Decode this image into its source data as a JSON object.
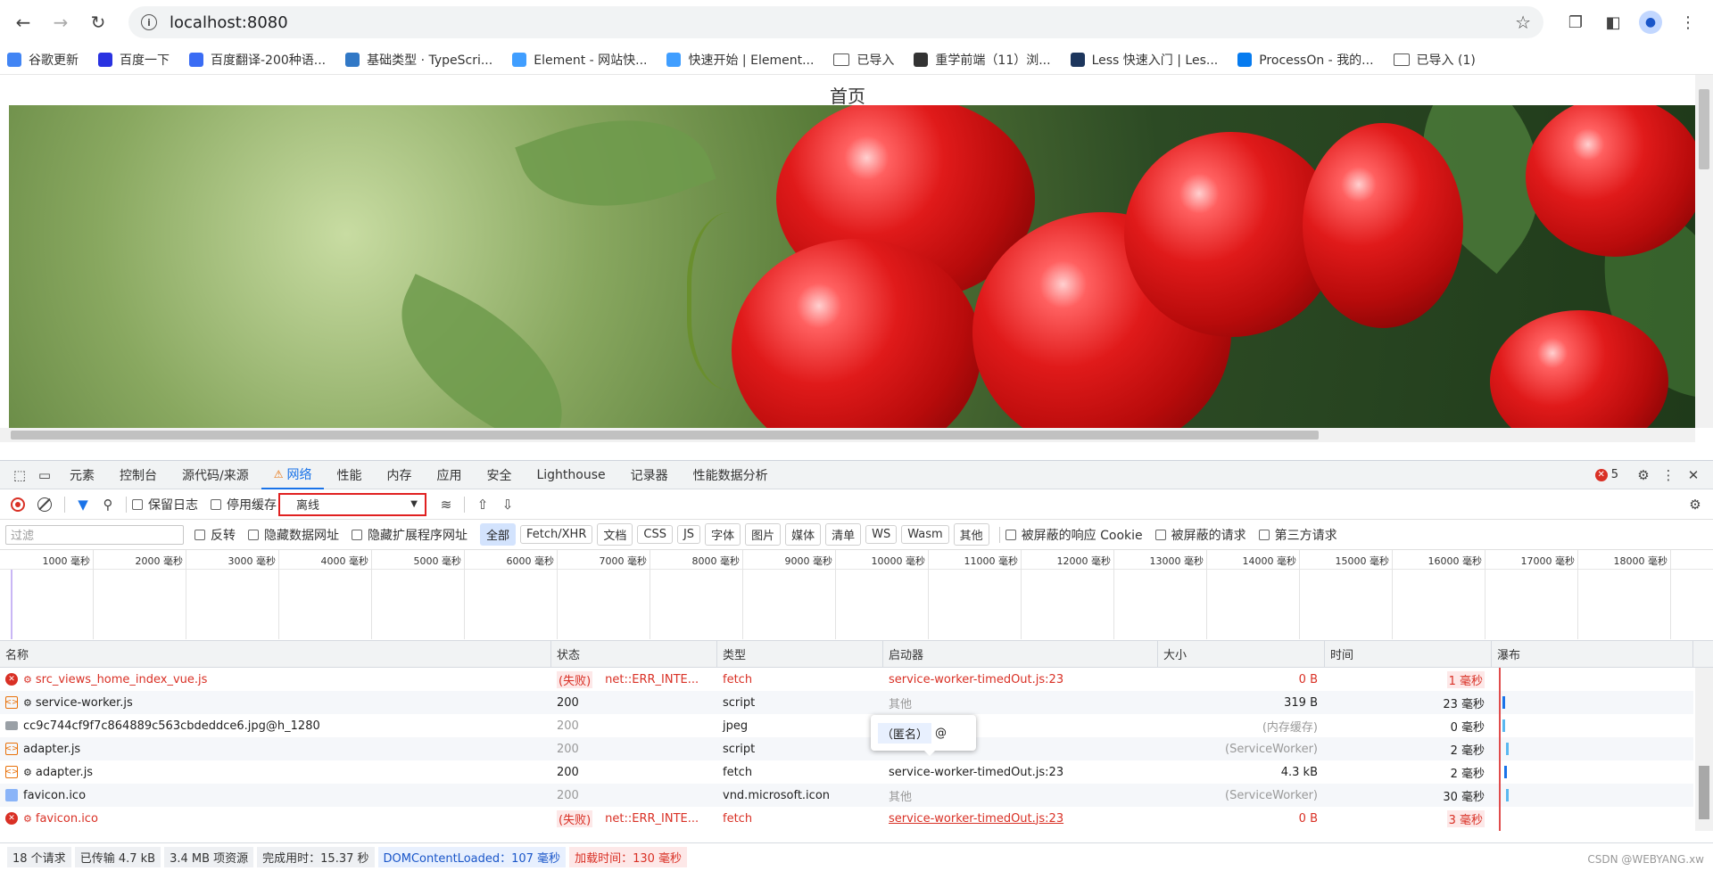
{
  "browser": {
    "url": "localhost:8080",
    "bookmarks": [
      {
        "label": "谷歌更新",
        "icon": "chrome-icon",
        "color": "#4285f4"
      },
      {
        "label": "百度一下",
        "icon": "baidu-icon",
        "color": "#2932e1"
      },
      {
        "label": "百度翻译-200种语...",
        "icon": "translate-icon",
        "color": "#3a6cf4"
      },
      {
        "label": "基础类型 · TypeScri...",
        "icon": "typescript-icon",
        "color": "#3178c6"
      },
      {
        "label": "Element - 网站快...",
        "icon": "element-icon",
        "color": "#409eff"
      },
      {
        "label": "快速开始 | Element...",
        "icon": "element-icon",
        "color": "#409eff"
      },
      {
        "label": "已导入",
        "icon": "folder-icon",
        "color": "#555555"
      },
      {
        "label": "重学前端（11）浏...",
        "icon": "bookmark-icon",
        "color": "#333333"
      },
      {
        "label": "Less 快速入门 | Les...",
        "icon": "less-icon",
        "color": "#1d365d"
      },
      {
        "label": "ProcessOn - 我的...",
        "icon": "processon-icon",
        "color": "#067bef"
      },
      {
        "label": "已导入 (1)",
        "icon": "folder-icon",
        "color": "#555555"
      }
    ]
  },
  "page": {
    "title": "首页"
  },
  "devtools": {
    "tabs": [
      "元素",
      "控制台",
      "源代码/来源",
      "网络",
      "性能",
      "内存",
      "应用",
      "安全",
      "Lighthouse",
      "记录器",
      "性能数据分析"
    ],
    "active_tab": "网络",
    "error_count": "5",
    "network": {
      "preserve_log": "保留日志",
      "disable_cache": "停用缓存",
      "throttle": "离线",
      "filter_placeholder": "过滤",
      "invert": "反转",
      "hide_data_urls": "隐藏数据网址",
      "hide_extension_urls": "隐藏扩展程序网址",
      "type_filters": [
        "全部",
        "Fetch/XHR",
        "文档",
        "CSS",
        "JS",
        "字体",
        "图片",
        "媒体",
        "清单",
        "WS",
        "Wasm",
        "其他"
      ],
      "blocked_cookies": "被屏蔽的响应 Cookie",
      "blocked_requests": "被屏蔽的请求",
      "third_party": "第三方请求",
      "timeline_ticks": [
        "1000 毫秒",
        "2000 毫秒",
        "3000 毫秒",
        "4000 毫秒",
        "5000 毫秒",
        "6000 毫秒",
        "7000 毫秒",
        "8000 毫秒",
        "9000 毫秒",
        "10000 毫秒",
        "11000 毫秒",
        "12000 毫秒",
        "13000 毫秒",
        "14000 毫秒",
        "15000 毫秒",
        "16000 毫秒",
        "17000 毫秒",
        "18000 毫秒"
      ],
      "columns": [
        "名称",
        "状态",
        "类型",
        "启动器",
        "大小",
        "时间",
        "瀑布"
      ],
      "rows": [
        {
          "name": "src_views_home_index_vue.js",
          "status": "(失败)",
          "status_detail": "net::ERR_INTE...",
          "type": "fetch",
          "initiator": "service-worker-timedOut.js:23",
          "size": "0 B",
          "time": "1 毫秒",
          "error": true,
          "icon": "error-icon",
          "sw": true
        },
        {
          "name": "service-worker.js",
          "status": "200",
          "status_detail": "",
          "type": "script",
          "initiator": "其他",
          "size": "319 B",
          "time": "23 毫秒",
          "error": false,
          "icon": "script-icon",
          "sw": true
        },
        {
          "name": "cc9c744cf9f7c864889c563cbdeddce6.jpg@h_1280",
          "status": "200",
          "status_detail": "",
          "type": "jpeg",
          "initiator": "",
          "size": "(内存缓存)",
          "time": "0 毫秒",
          "error": false,
          "icon": "image-icon",
          "sw": false
        },
        {
          "name": "adapter.js",
          "status": "200",
          "status_detail": "",
          "type": "script",
          "initiator": "",
          "size": "(ServiceWorker)",
          "time": "2 毫秒",
          "error": false,
          "icon": "script-icon",
          "sw": false
        },
        {
          "name": "adapter.js",
          "status": "200",
          "status_detail": "",
          "type": "fetch",
          "initiator": "service-worker-timedOut.js:23",
          "size": "4.3 kB",
          "time": "2 毫秒",
          "error": false,
          "icon": "script-icon",
          "sw": true
        },
        {
          "name": "favicon.ico",
          "status": "200",
          "status_detail": "",
          "type": "vnd.microsoft.icon",
          "initiator": "其他",
          "size": "(ServiceWorker)",
          "time": "30 毫秒",
          "error": false,
          "icon": "favicon-icon",
          "sw": false
        },
        {
          "name": "favicon.ico",
          "status": "(失败)",
          "status_detail": "net::ERR_INTE...",
          "type": "fetch",
          "initiator": "service-worker-timedOut.js:23",
          "size": "0 B",
          "time": "3 毫秒",
          "error": true,
          "icon": "error-icon",
          "sw": true
        }
      ],
      "tooltip": {
        "name": "（匿名）",
        "at": "@"
      },
      "status_bar": [
        "18 个请求",
        "已传输 4.7 kB",
        "3.4 MB 项资源",
        "完成用时：15.37 秒",
        "DOMContentLoaded：107 毫秒",
        "加载时间：130 毫秒"
      ]
    }
  },
  "watermark": "CSDN @WEBYANG.xw"
}
